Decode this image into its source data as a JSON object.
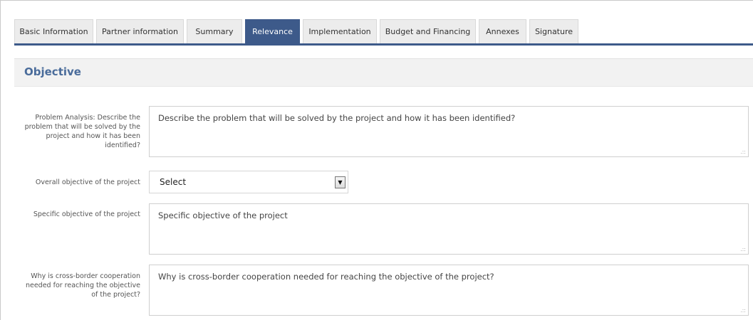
{
  "tabs": [
    {
      "label": "Basic Information",
      "active": false
    },
    {
      "label": "Partner information",
      "active": false
    },
    {
      "label": "Summary",
      "active": false
    },
    {
      "label": "Relevance",
      "active": true
    },
    {
      "label": "Implementation",
      "active": false
    },
    {
      "label": "Budget and Financing",
      "active": false
    },
    {
      "label": "Annexes",
      "active": false
    },
    {
      "label": "Signature",
      "active": false
    }
  ],
  "section": {
    "title": "Objective"
  },
  "fields": {
    "problem_analysis": {
      "label": "Problem Analysis: Describe the problem that will be solved by the project and how it has been identified?",
      "placeholder": "Describe the problem that will be solved by the project and how it has been identified?"
    },
    "overall_objective": {
      "label": "Overall objective of the project",
      "value": "Select"
    },
    "specific_objective": {
      "label": "Specific objective of the project",
      "placeholder": "Specific objective of the project"
    },
    "cross_border": {
      "label": "Why is cross-border cooperation needed for reaching the objective of the project?",
      "placeholder": "Why is cross-border cooperation needed for reaching the objective of the project?"
    }
  },
  "colors": {
    "accent": "#3d5a8a",
    "title": "#4a6c9b"
  }
}
